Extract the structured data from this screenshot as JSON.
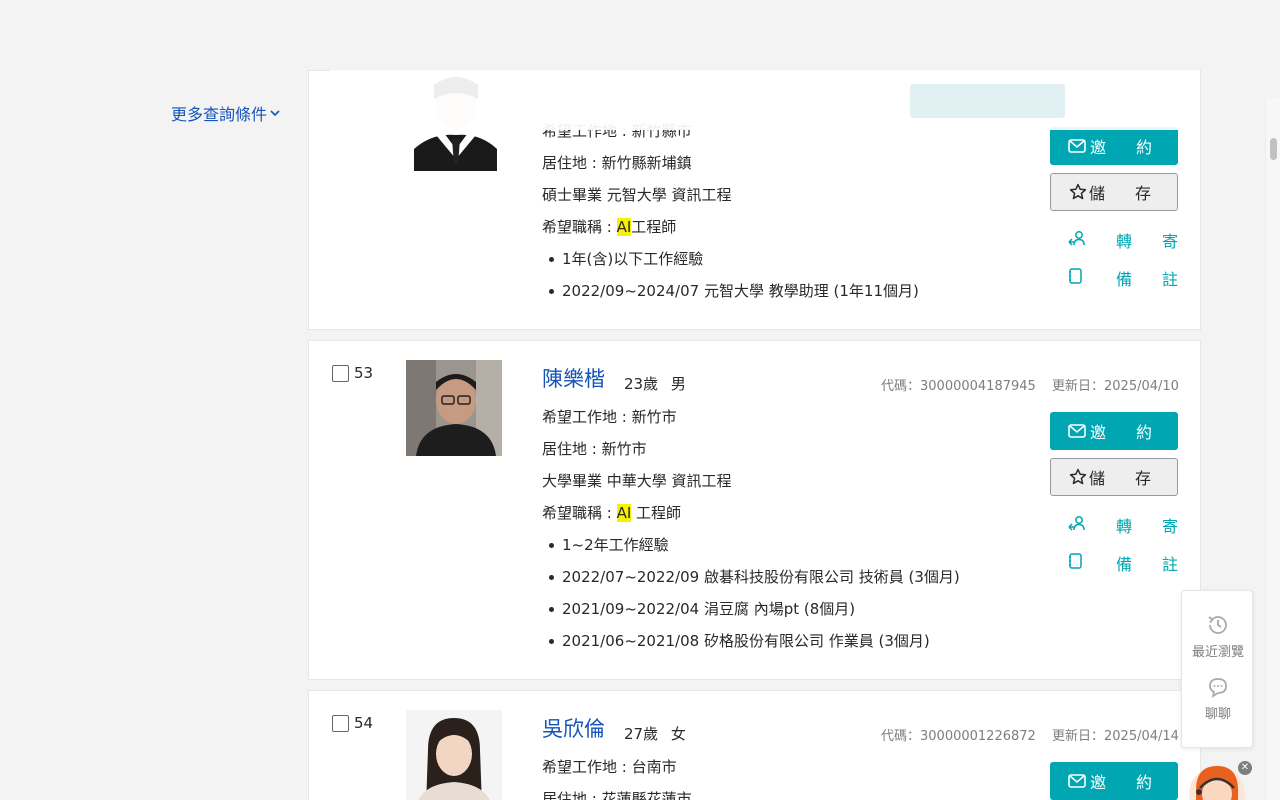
{
  "filter": {
    "more_label": "更多查詢條件"
  },
  "candidates": [
    {
      "index": "",
      "name": "",
      "age_sex": "",
      "code": "",
      "updated": "",
      "work_location": "希望工作地 : 新竹縣市",
      "residence": "居住地 : 新竹縣新埔鎮",
      "education": "碩士畢業 元智大學 資訊工程",
      "job_title_prefix": "希望職稱 : ",
      "job_title_highlight": "AI",
      "job_title_suffix": "工程師",
      "experience": [
        "1年(含)以下工作經驗",
        "2022/09~2024/07 元智大學 教學助理 (1年11個月)"
      ]
    },
    {
      "index": "53",
      "name": "陳樂楷",
      "age_sex": "23歲 男",
      "code": "代碼：30000004187945",
      "updated": "更新日：2025/04/10",
      "work_location": "希望工作地 : 新竹市",
      "residence": "居住地 : 新竹市",
      "education": "大學畢業 中華大學 資訊工程",
      "job_title_prefix": "希望職稱 : ",
      "job_title_highlight": "AI",
      "job_title_suffix": " 工程師",
      "experience": [
        "1~2年工作經驗",
        "2022/07~2022/09 啟碁科技股份有限公司 技術員 (3個月)",
        "2021/09~2022/04 涓豆腐 內場pt (8個月)",
        "2021/06~2021/08 矽格股份有限公司 作業員 (3個月)"
      ]
    },
    {
      "index": "54",
      "name": "吳欣倫",
      "age_sex": "27歲 女",
      "code": "代碼：30000001226872",
      "updated": "更新日：2025/04/14",
      "work_location": "希望工作地 : 台南市",
      "residence": "居住地 : 花蓮縣花蓮市"
    }
  ],
  "actions": {
    "invite": "邀約",
    "save": "儲存",
    "forward": "轉寄",
    "note": "備註"
  },
  "side_panel": {
    "recent": "最近瀏覽",
    "chat": "聊聊"
  },
  "colors": {
    "accent": "#00a6b2",
    "name_link": "#1654b9",
    "highlight": "#f7f200"
  }
}
